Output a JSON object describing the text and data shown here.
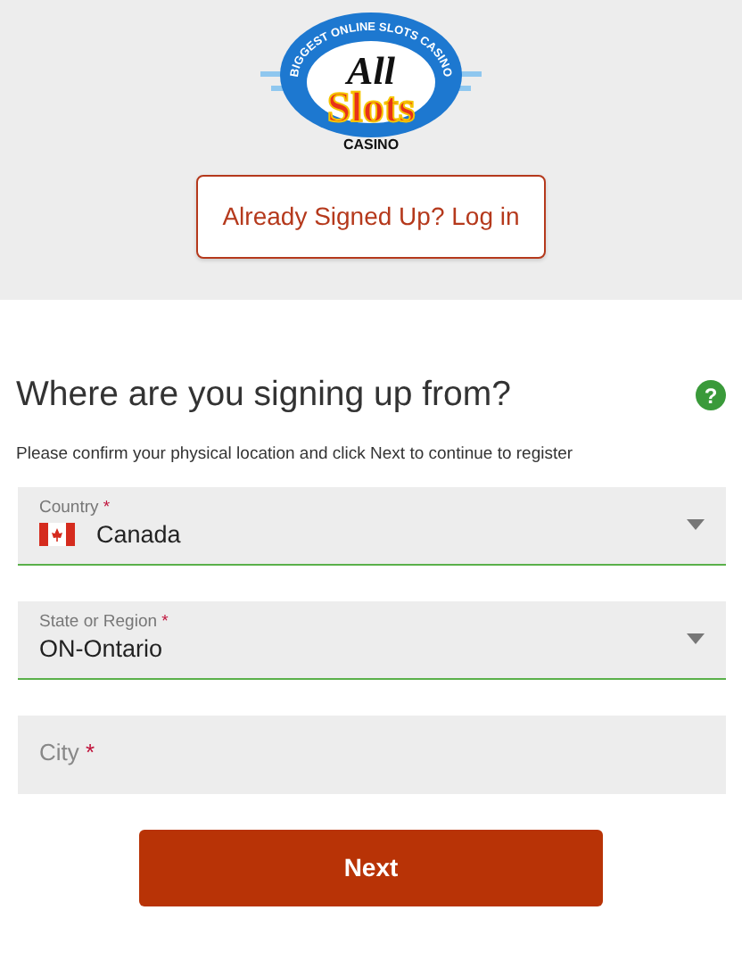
{
  "logo": {
    "arc_text": "BIGGEST ONLINE SLOTS CASINO",
    "line_1": "All",
    "line_2": "Slots",
    "line_3": "CASINO"
  },
  "login_button": "Already Signed Up? Log in",
  "heading": "Where are you signing up from?",
  "help_icon": "?",
  "instructions": "Please confirm your physical location and click Next to continue to register",
  "fields": [
    {
      "kind": "select",
      "label": "Country",
      "required_mark": "*",
      "value": "Canada",
      "flag": {
        "kind": "canada"
      },
      "valid": true
    },
    {
      "kind": "select",
      "label": "State or Region",
      "required_mark": "*",
      "value": "ON-Ontario",
      "valid": true
    },
    {
      "kind": "text",
      "placeholder": "City",
      "required_mark": "*",
      "valid": false
    }
  ],
  "next_button": "Next"
}
